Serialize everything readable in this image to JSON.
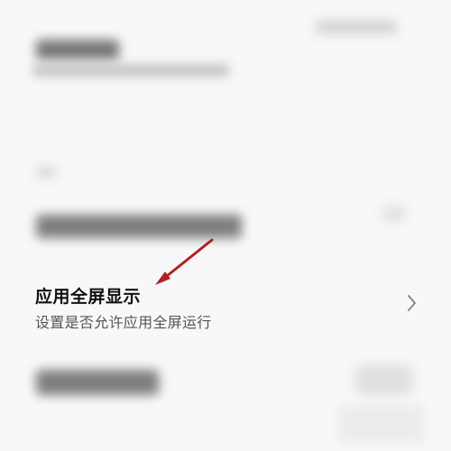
{
  "setting": {
    "title": "应用全屏显示",
    "subtitle": "设置是否允许应用全屏运行"
  },
  "icons": {
    "chevron": "chevron-right-icon",
    "annotation": "annotation-arrow-icon"
  },
  "colors": {
    "annotation_arrow": "#b1201f"
  }
}
